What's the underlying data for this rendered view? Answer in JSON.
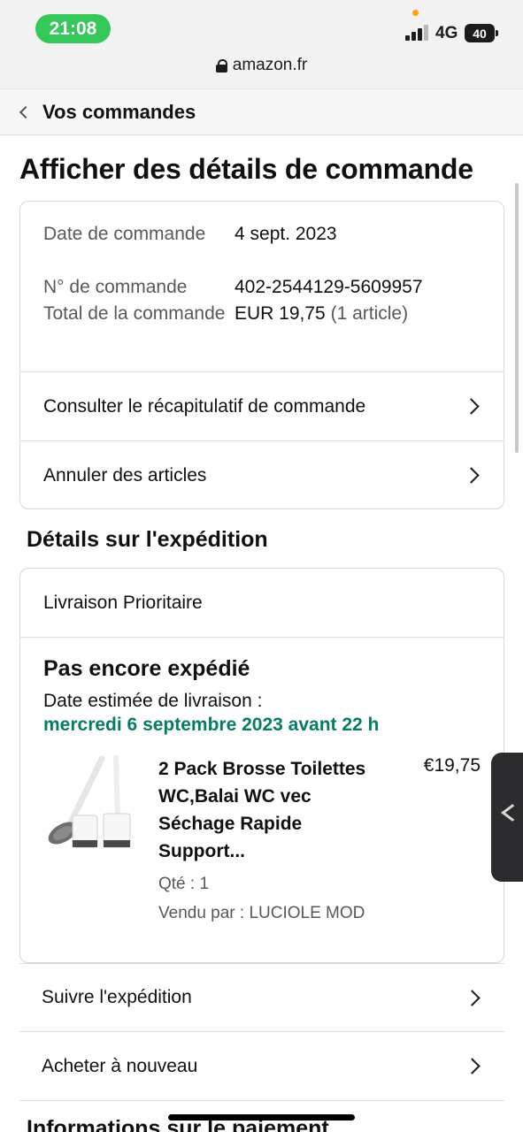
{
  "status_bar": {
    "time": "21:08",
    "network": "4G",
    "battery": "40",
    "url": "amazon.fr"
  },
  "nav": {
    "back_label": "Vos commandes"
  },
  "page_title": "Afficher des détails de commande",
  "order_summary": {
    "date_label": "Date de commande",
    "date_value": "4 sept. 2023",
    "number_label": "N° de commande",
    "number_value": "402-2544129-5609957",
    "total_label": "Total de la commande",
    "total_value": "EUR 19,75",
    "total_items": "(1 article)"
  },
  "order_links": [
    {
      "label": "Consulter le récapitulatif de commande"
    },
    {
      "label": "Annuler des articles"
    }
  ],
  "shipping": {
    "section_title": "Détails sur l'expédition",
    "delivery_type": "Livraison Prioritaire",
    "status": "Pas encore expédié",
    "estimated_label": "Date estimée de livraison :",
    "estimated_date": "mercredi 6 septembre 2023 avant 22 h",
    "status_color": "#067d62",
    "product": {
      "title": "2 Pack Brosse Toilettes WC,Balai WC vec Séchage Rapide Support...",
      "qty": "Qté : 1",
      "seller": "Vendu par : LUCIOLE MOD",
      "price": "€19,75"
    }
  },
  "actions": [
    {
      "label": "Suivre l'expédition"
    },
    {
      "label": "Acheter à nouveau"
    }
  ],
  "next_section_title": "Informations sur le paiement"
}
